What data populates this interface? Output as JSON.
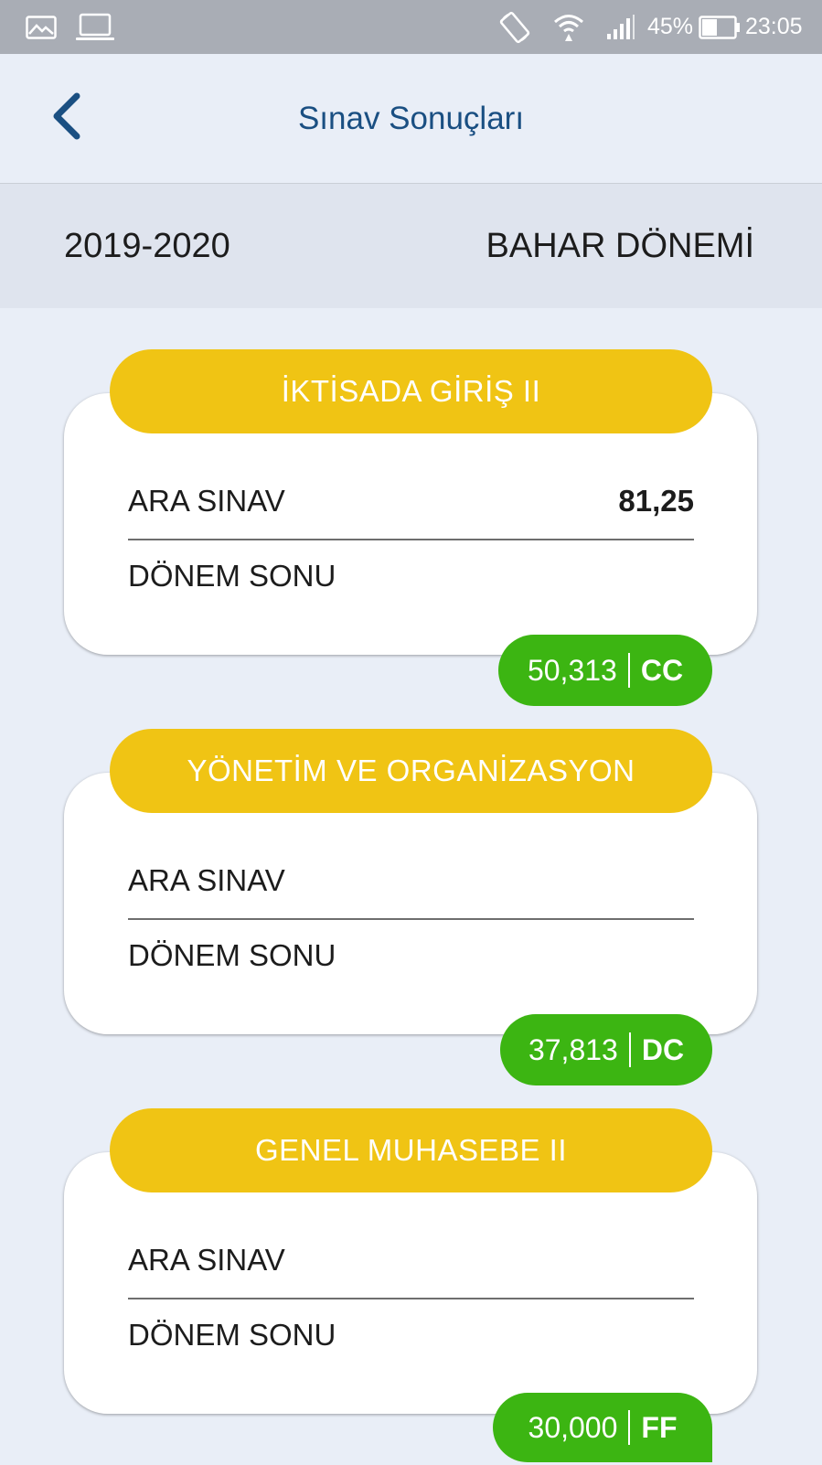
{
  "status_bar": {
    "battery_percent": "45%",
    "time": "23:05",
    "left_icons": [
      "gallery-icon",
      "laptop-icon"
    ],
    "right_icons": [
      "rotate-icon",
      "wifi-icon",
      "signal-icon",
      "battery-icon"
    ]
  },
  "header": {
    "title": "Sınav Sonuçları",
    "back_icon": "chevron-left-icon",
    "accent_color": "#1a4f82"
  },
  "term": {
    "year": "2019-2020",
    "semester": "BAHAR DÖNEMİ"
  },
  "courses": [
    {
      "title": "İKTİSADA GİRİŞ II",
      "midterm_label": "ARA SINAV",
      "midterm_score": "81,25",
      "final_label": "DÖNEM SONU",
      "final_score": "",
      "average": "50,313",
      "letter_grade": "CC"
    },
    {
      "title": "YÖNETİM VE ORGANİZASYON",
      "midterm_label": "ARA SINAV",
      "midterm_score": "",
      "final_label": "DÖNEM SONU",
      "final_score": "",
      "average": "37,813",
      "letter_grade": "DC"
    },
    {
      "title": "GENEL MUHASEBE II",
      "midterm_label": "ARA SINAV",
      "midterm_score": "",
      "final_label": "DÖNEM SONU",
      "final_score": "",
      "average": "30,000",
      "letter_grade": "FF"
    }
  ],
  "colors": {
    "title_pill": "#f0c414",
    "grade_badge": "#3cb512",
    "background": "#e9eef7"
  }
}
